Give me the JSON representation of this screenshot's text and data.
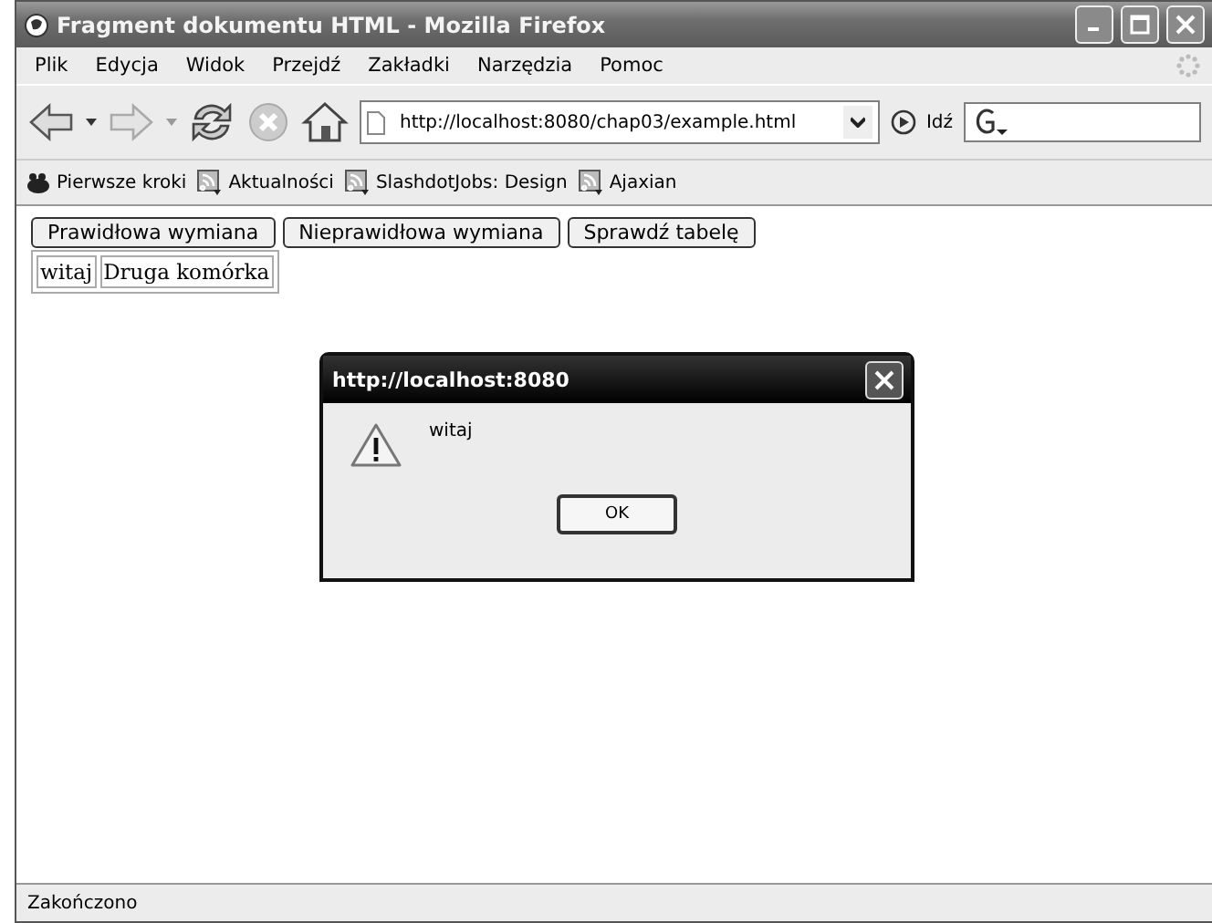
{
  "window": {
    "title": "Fragment dokumentu HTML - Mozilla Firefox"
  },
  "menu": [
    "Plik",
    "Edycja",
    "Widok",
    "Przejdź",
    "Zakładki",
    "Narzędzia",
    "Pomoc"
  ],
  "toolbar": {
    "url": "http://localhost:8080/chap03/example.html",
    "go_label": "Idź"
  },
  "bookmarks": [
    {
      "label": "Pierwsze kroki",
      "kind": "page"
    },
    {
      "label": "Aktualności",
      "kind": "feed"
    },
    {
      "label": "SlashdotJobs: Design",
      "kind": "feed"
    },
    {
      "label": "Ajaxian",
      "kind": "feed"
    }
  ],
  "page": {
    "buttons": [
      "Prawidłowa wymiana",
      "Nieprawidłowa wymiana",
      "Sprawdź tabelę"
    ],
    "table_cells": [
      "witaj",
      "Druga komórka"
    ]
  },
  "dialog": {
    "title": "http://localhost:8080",
    "message": "witaj",
    "button": "OK"
  },
  "status_bar": "Zakończono"
}
